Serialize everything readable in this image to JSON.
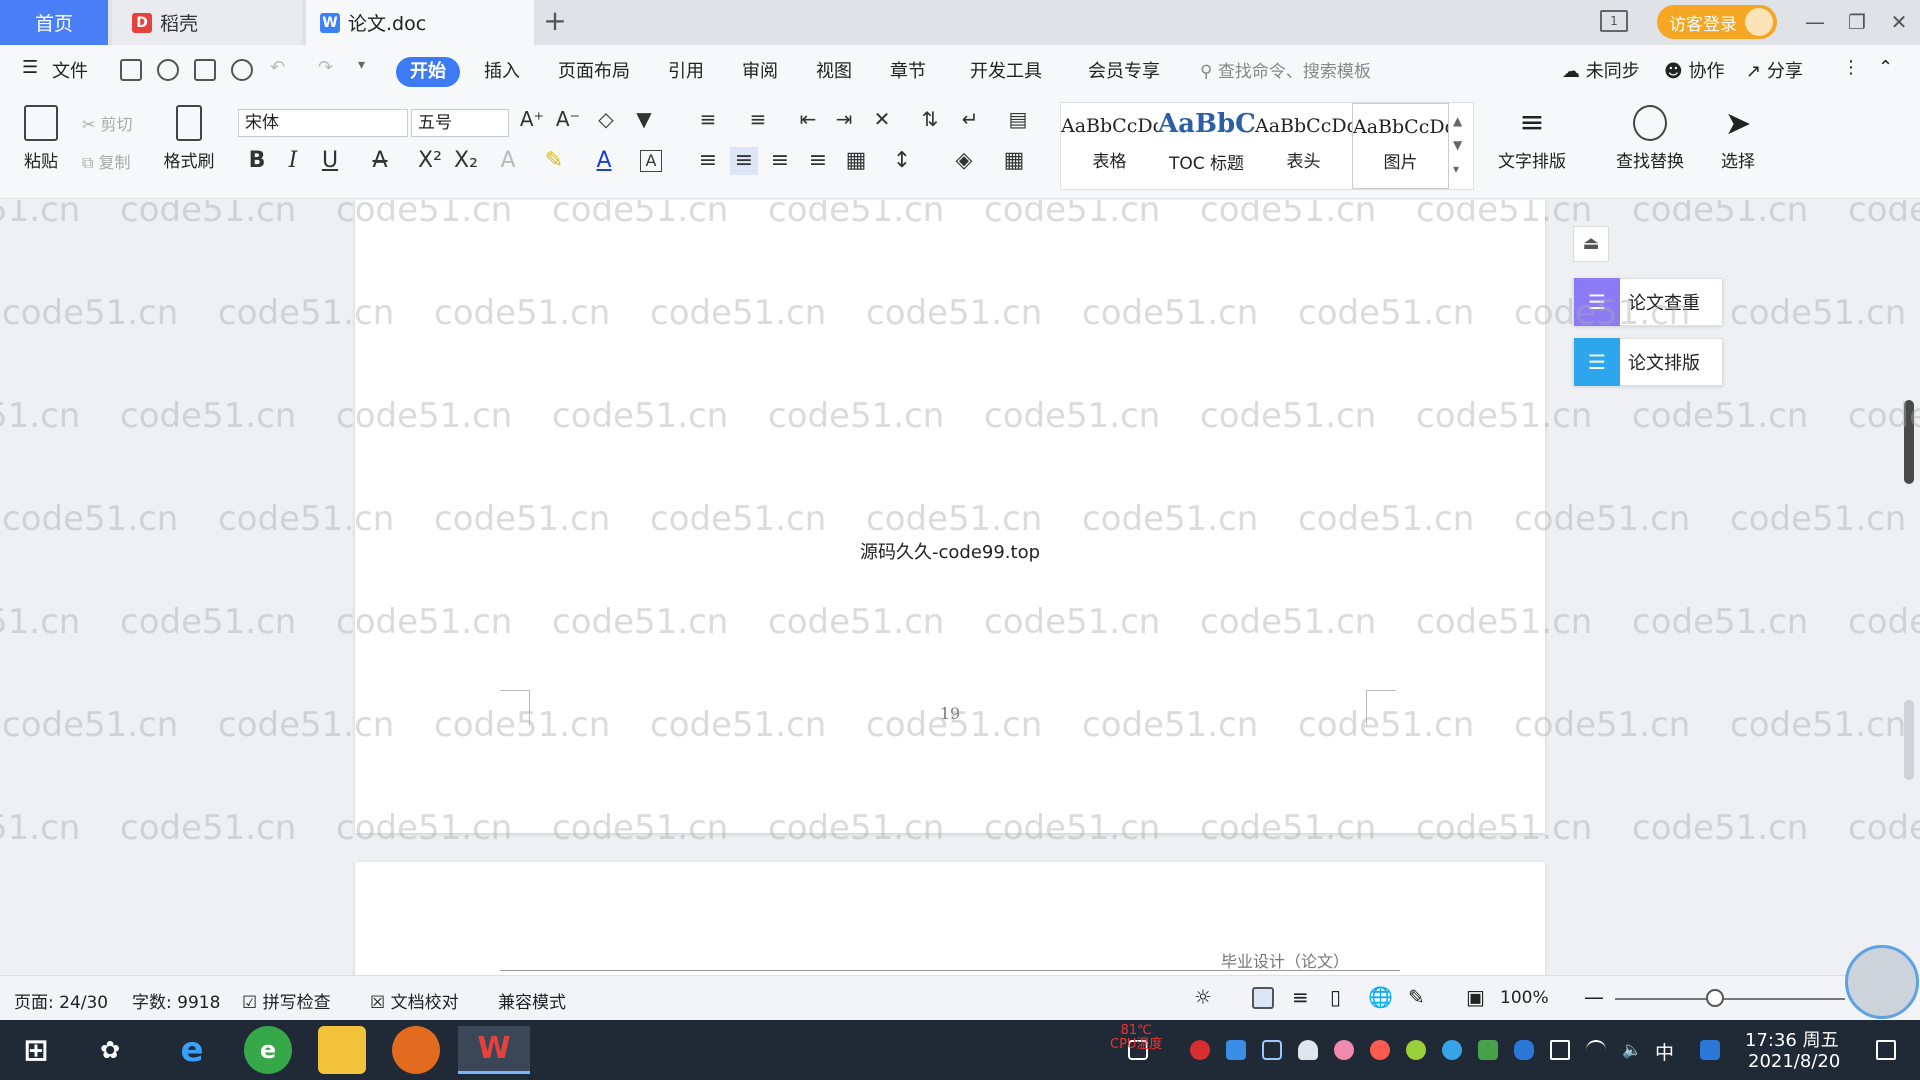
{
  "tabs": {
    "home": "首页",
    "docer": "稻壳",
    "doc": "论文.doc"
  },
  "header": {
    "visitor_login": "访客登录"
  },
  "menu": {
    "file": "文件",
    "items": [
      "开始",
      "插入",
      "页面布局",
      "引用",
      "审阅",
      "视图",
      "章节",
      "开发工具",
      "会员专享"
    ],
    "search_placeholder": "查找命令、搜索模板",
    "unsynced": "未同步",
    "collab": "协作",
    "share": "分享"
  },
  "ribbon": {
    "paste": "粘贴",
    "cut": "剪切",
    "copy": "复制",
    "format_painter": "格式刷",
    "font_name": "宋体",
    "font_size": "五号",
    "styles": [
      {
        "sample": "AaBbCcDd",
        "name": "表格"
      },
      {
        "sample": "AaBbCc",
        "name": "TOC 标题"
      },
      {
        "sample": "AaBbCcDd",
        "name": "表头"
      },
      {
        "sample": "AaBbCcDd",
        "name": "图片"
      }
    ],
    "text_layout": "文字排版",
    "find_replace": "查找替换",
    "select": "选择"
  },
  "document": {
    "body_text": "源码久久-code99.top",
    "page_number": "19",
    "next_page_header": "毕业设计（论文）",
    "watermark": "code51.cn"
  },
  "side_panel": {
    "check": "论文查重",
    "layout": "论文排版"
  },
  "status": {
    "page": "页面: 24/30",
    "words": "字数: 9918",
    "spell_check": "拼写检查",
    "proofread": "文档校对",
    "compat": "兼容模式",
    "zoom": "100%"
  },
  "taskbar": {
    "cpu_value": "81℃",
    "cpu_label": "CPU温度",
    "ime": "中",
    "time": "17:36 周五",
    "date": "2021/8/20"
  },
  "colors": {
    "accent": "#3d7bf5",
    "visitor": "#f5a623",
    "taskbar": "#1f2a36"
  }
}
